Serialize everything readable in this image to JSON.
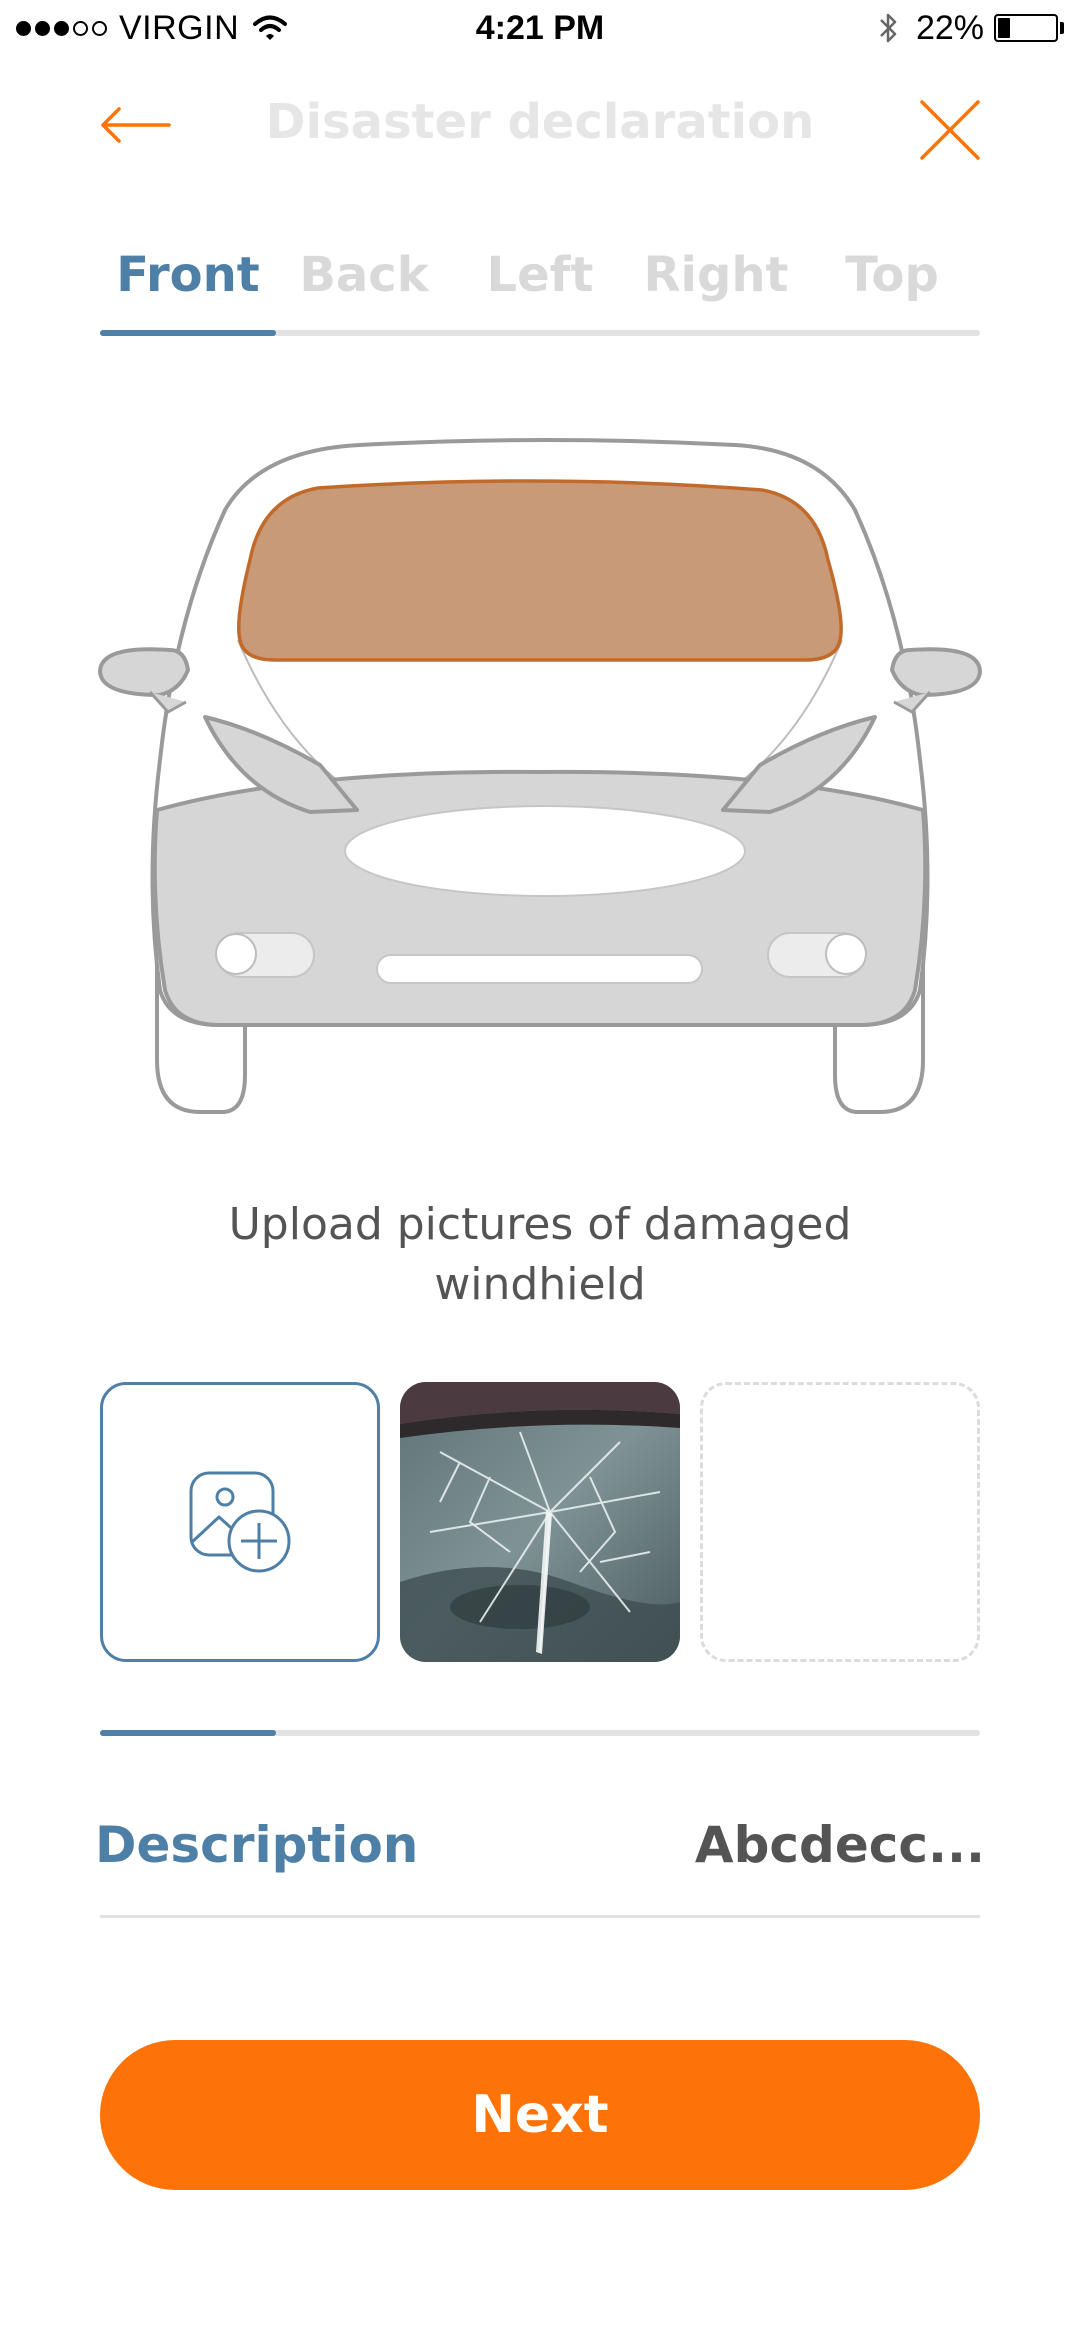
{
  "status_bar": {
    "carrier": "VIRGIN",
    "time": "4:21 PM",
    "battery": "22%",
    "signal_icon": "signal-dots-icon",
    "wifi_icon": "wifi-icon",
    "bluetooth_icon": "bluetooth-icon"
  },
  "header": {
    "title": "Disaster declaration",
    "back_icon": "arrow-left-icon",
    "close_icon": "close-icon"
  },
  "tabs": [
    {
      "label": "Front",
      "active": true
    },
    {
      "label": "Back",
      "active": false
    },
    {
      "label": "Left",
      "active": false
    },
    {
      "label": "Right",
      "active": false
    },
    {
      "label": "Top",
      "active": false
    }
  ],
  "car": {
    "highlighted_part": "windshield",
    "highlight_color": "#c99a78"
  },
  "instruction": "Upload pictures of damaged windhield",
  "photos": {
    "add_icon": "add-photo-icon",
    "slots": [
      "add",
      "photo",
      "empty"
    ]
  },
  "description": {
    "label": "Description",
    "value": "Abcdecc..."
  },
  "next_button": {
    "label": "Next"
  },
  "colors": {
    "accent": "#4e7fa6",
    "primary": "#fd7308",
    "inactive": "#d9d9d9"
  }
}
